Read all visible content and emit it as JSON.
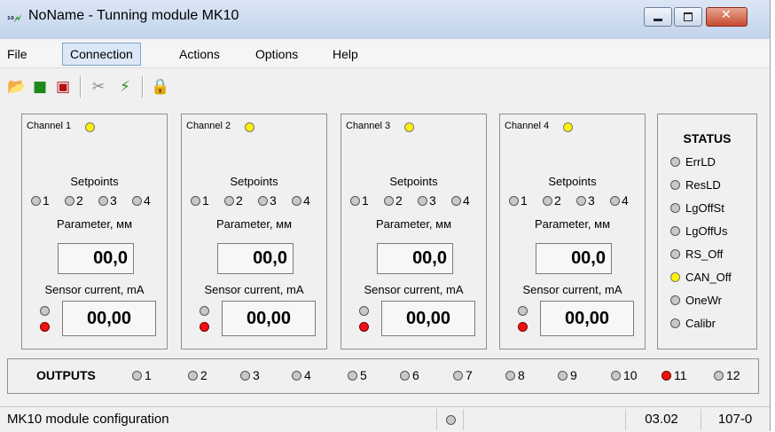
{
  "window": {
    "title": "NoName - Tunning module MK10",
    "icon": "app-icon",
    "controls": [
      "minimize-icon",
      "maximize-icon",
      "close-icon"
    ]
  },
  "menu": {
    "items": [
      {
        "label": "File"
      },
      {
        "label": "Connection"
      },
      {
        "label": "Actions"
      },
      {
        "label": "Options"
      },
      {
        "label": "Help"
      }
    ],
    "active": "Connection"
  },
  "toolbar": {
    "tools": [
      "open-folder-icon",
      "save-icon",
      "save-as-icon",
      "disconnect-icon",
      "connect-icon",
      "lock-icon"
    ]
  },
  "channels": [
    {
      "label": "Channel 1",
      "setpoints_title": "Setpoints",
      "setpoints": [
        "1",
        "2",
        "3",
        "4"
      ],
      "param_label": "Parameter, мм",
      "param_value": "00,0",
      "sensor_label": "Sensor current, mA",
      "sensor_value": "00,00"
    },
    {
      "label": "Channel 2",
      "setpoints_title": "Setpoints",
      "setpoints": [
        "1",
        "2",
        "3",
        "4"
      ],
      "param_label": "Parameter, мм",
      "param_value": "00,0",
      "sensor_label": "Sensor current, mA",
      "sensor_value": "00,00"
    },
    {
      "label": "Channel 3",
      "setpoints_title": "Setpoints",
      "setpoints": [
        "1",
        "2",
        "3",
        "4"
      ],
      "param_label": "Parameter, мм",
      "param_value": "00,0",
      "sensor_label": "Sensor current, mA",
      "sensor_value": "00,00"
    },
    {
      "label": "Channel 4",
      "setpoints_title": "Setpoints",
      "setpoints": [
        "1",
        "2",
        "3",
        "4"
      ],
      "param_label": "Parameter, мм",
      "param_value": "00,0",
      "sensor_label": "Sensor current, mA",
      "sensor_value": "00,00"
    }
  ],
  "status": {
    "title": "STATUS",
    "items": [
      {
        "label": "ErrLD",
        "color": "#c8c8c8"
      },
      {
        "label": "ResLD",
        "color": "#c8c8c8"
      },
      {
        "label": "LgOffSt",
        "color": "#c8c8c8"
      },
      {
        "label": "LgOffUs",
        "color": "#c8c8c8"
      },
      {
        "label": "RS_Off",
        "color": "#c8c8c8"
      },
      {
        "label": "CAN_Off",
        "color": "#fff200"
      },
      {
        "label": "OneWr",
        "color": "#c8c8c8"
      },
      {
        "label": "Calibr",
        "color": "#c8c8c8"
      }
    ]
  },
  "outputs": {
    "title": "OUTPUTS",
    "items": [
      "1",
      "2",
      "3",
      "4",
      "5",
      "6",
      "7",
      "8",
      "9",
      "10",
      "11",
      "12"
    ],
    "active_output": "11"
  },
  "statusbar": {
    "message": "MK10 module configuration",
    "version": "03.02",
    "code": "107-0"
  }
}
